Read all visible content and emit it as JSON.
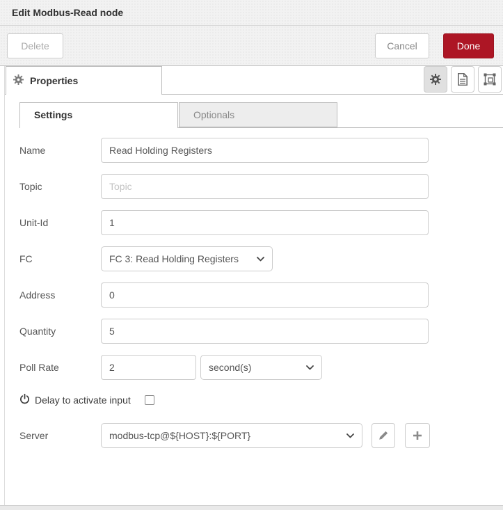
{
  "dialog": {
    "title": "Edit Modbus-Read node"
  },
  "header_buttons": {
    "delete": "Delete",
    "cancel": "Cancel",
    "done": "Done"
  },
  "tray": {
    "properties_tab_label": "Properties",
    "icon_buttons": [
      "gear",
      "description",
      "appearance"
    ]
  },
  "tabs": {
    "settings": "Settings",
    "optionals": "Optionals"
  },
  "form": {
    "name": {
      "label": "Name",
      "value": "Read Holding Registers"
    },
    "topic": {
      "label": "Topic",
      "placeholder": "Topic"
    },
    "unit_id": {
      "label": "Unit-Id",
      "value": "1"
    },
    "fc": {
      "label": "FC",
      "selected": "FC 3: Read Holding Registers"
    },
    "address": {
      "label": "Address",
      "value": "0"
    },
    "quantity": {
      "label": "Quantity",
      "value": "5"
    },
    "poll_rate": {
      "label": "Poll Rate",
      "value": "2",
      "unit_selected": "second(s)"
    },
    "delay": {
      "label": "Delay to activate input",
      "checked": false
    },
    "server": {
      "label": "Server",
      "selected": "modbus-tcp@${HOST}:${PORT}"
    }
  },
  "colors": {
    "accent_red": "#AD1625",
    "panel_gray": "#f2f2f2",
    "border_gray": "#bbbbbb"
  }
}
